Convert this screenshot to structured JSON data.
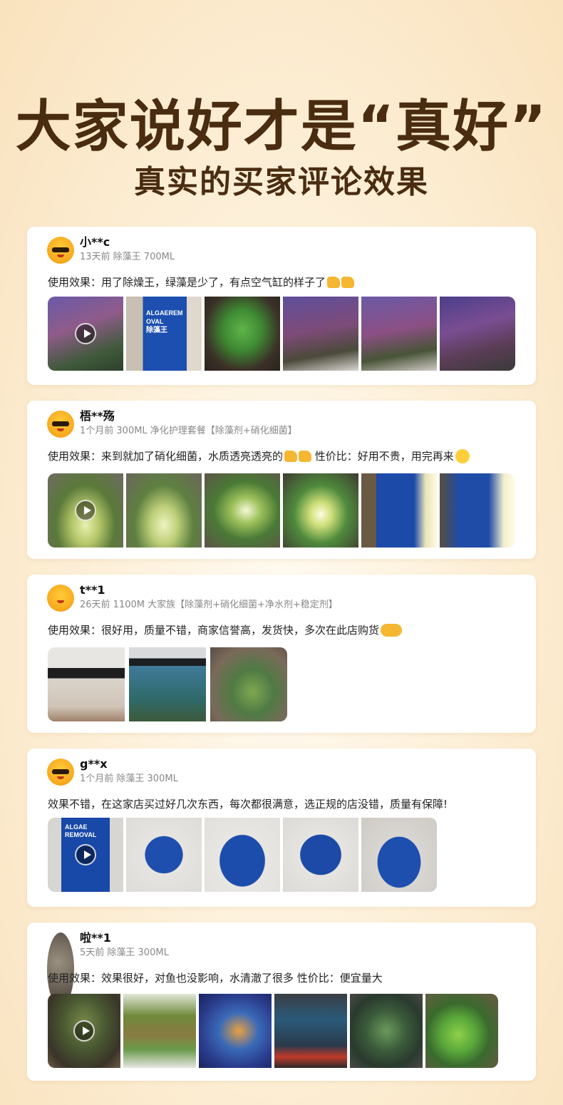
{
  "hero": {
    "title": "大家说好才是“真好”",
    "subtitle": "真实的买家评论效果"
  },
  "reviews": [
    {
      "username": "小**c",
      "meta": "13天前 除藻王 700ML",
      "comment": "使用效果：用了除燥王，绿藻是少了，有点空气缸的样子了",
      "emoji": "thumbs-up-icon",
      "photos": 6,
      "has_video": true
    },
    {
      "username": "梧**殇",
      "meta": "1个月前 300ML 净化护理套餐【除藻剂+硝化细菌】",
      "comment": "使用效果：来到就加了硝化细菌，水质透亮透亮的",
      "comment_tail": "性价比：好用不贵，用完再来",
      "emoji": "thumbs-up-icon",
      "photos": 6,
      "has_video": true
    },
    {
      "username": "t**1",
      "meta": "26天前 1100M 大家族【除藻剂+硝化细菌+净水剂+稳定剂】",
      "comment": "使用效果：很好用，质量不错，商家信誉高，发货快，多次在此店购货",
      "emoji": "handshake-icon",
      "photos": 3,
      "has_video": false
    },
    {
      "username": "g**x",
      "meta": "1个月前 除藻王 300ML",
      "comment": "效果不错，在这家店买过好几次东西，每次都很满意，选正规的店没错，质量有保障!",
      "photos": 5,
      "has_video": true
    },
    {
      "username": "啦**1",
      "meta": "5天前 除藻王 300ML",
      "comment": "使用效果：效果很好，对鱼也没影响，水清澈了很多 性价比：便宜量大",
      "photos": 6,
      "has_video": true
    }
  ],
  "bottle_text": {
    "algaerem": "ALGAEREM",
    "oval": "OVAL",
    "cn": "除藻王",
    "algae": "ALGAE",
    "removal": "REMOVAL"
  }
}
